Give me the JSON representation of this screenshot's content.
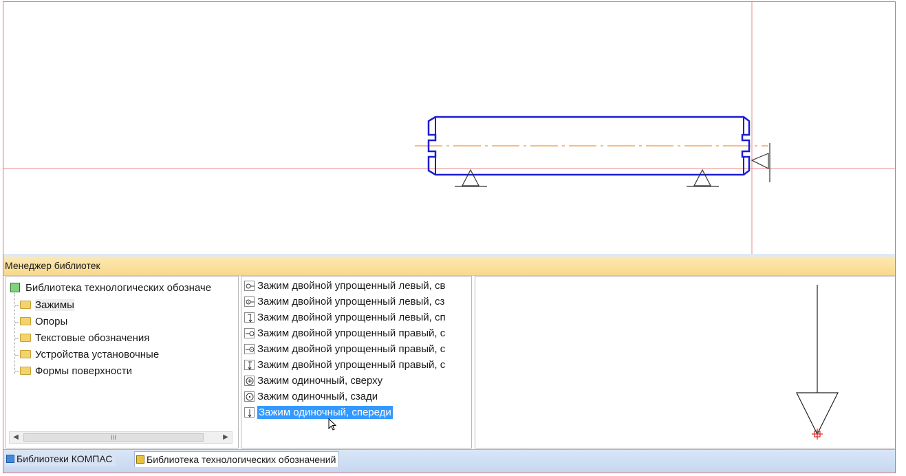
{
  "library_manager": {
    "title": "Менеджер библиотек",
    "tree": {
      "root": "Библиотека технологических обозначе",
      "folders": [
        "Зажимы",
        "Опоры",
        "Текстовые обозначения",
        "Устройства установочные",
        "Формы поверхности"
      ],
      "selected_folder": "Зажимы"
    },
    "list": {
      "items": [
        {
          "label": "Зажим двойной упрощенный левый, св",
          "icon": "clamp-double-left-top-icon"
        },
        {
          "label": "Зажим двойной упрощенный левый, сз",
          "icon": "clamp-double-left-back-icon"
        },
        {
          "label": "Зажим двойной упрощенный левый, сп",
          "icon": "clamp-double-left-front-icon"
        },
        {
          "label": "Зажим двойной упрощенный правый, с",
          "icon": "clamp-double-right-top-icon"
        },
        {
          "label": "Зажим двойной упрощенный правый, с",
          "icon": "clamp-double-right-back-icon"
        },
        {
          "label": "Зажим двойной упрощенный правый, с",
          "icon": "clamp-double-right-front-icon"
        },
        {
          "label": "Зажим одиночный, сверху",
          "icon": "clamp-single-top-icon"
        },
        {
          "label": "Зажим одиночный, сзади",
          "icon": "clamp-single-back-icon"
        },
        {
          "label": "Зажим одиночный, спереди",
          "icon": "clamp-single-front-icon"
        }
      ],
      "selected_index": 8
    },
    "scrollbar_grip": "III"
  },
  "tabs": [
    "Библиотеки КОМПАС",
    "Библиотека технологических обозначений"
  ],
  "colors": {
    "shaft_outline": "#1c1cd6",
    "axis_line": "#f2a65a",
    "crosshair": "#e88a8a",
    "selection": "#3399ff",
    "header_bg": "#f8d88c",
    "preview_marker": "#e02020"
  }
}
